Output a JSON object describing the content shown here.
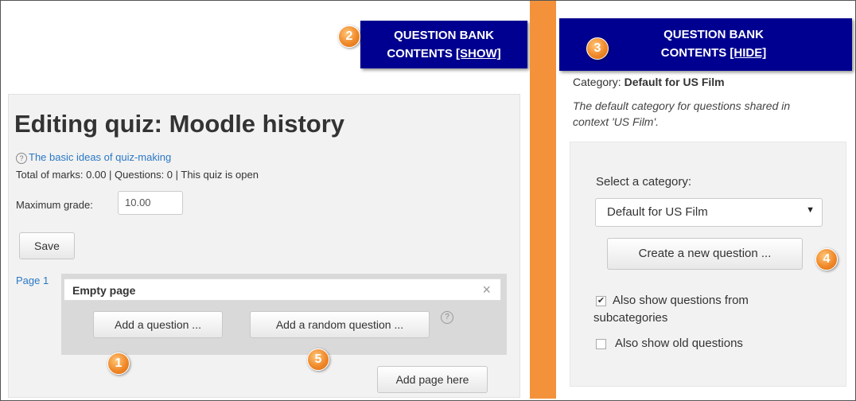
{
  "left": {
    "qb_tab": {
      "line1": "QUESTION BANK",
      "line2_prefix": "CONTENTS ",
      "line2_link": "[SHOW]"
    },
    "badge2": "2",
    "title": "Editing quiz: Moodle history",
    "help_icon": "?",
    "help_link": "The basic ideas of quiz-making",
    "totals": "Total of marks: 0.00 | Questions: 0 | This quiz is open",
    "max_grade_label": "Maximum grade:",
    "max_grade_value": "10.00",
    "save_label": "Save",
    "page_label": "Page 1",
    "empty_page": "Empty page",
    "close_glyph": "×",
    "add_question": "Add a question ...",
    "add_random_question": "Add a random question ...",
    "random_help_icon": "?",
    "add_page_here": "Add page here",
    "badge1": "1",
    "badge5": "5"
  },
  "right": {
    "qb_tab": {
      "line1": "QUESTION BANK",
      "line2_prefix": "CONTENTS ",
      "line2_link": "[HIDE]"
    },
    "badge3": "3",
    "category_prefix": "Category: ",
    "category_name": "Default for US Film",
    "category_desc": "The default category for questions shared in context 'US Film'.",
    "select_label": "Select a category:",
    "select_value": "Default for US Film",
    "create_button": "Create a new question ...",
    "badge4": "4",
    "show_sub_label": "Also show questions from subcategories",
    "show_sub_checked": true,
    "show_old_label": "Also show old questions",
    "show_old_checked": false
  },
  "colors": {
    "tab_bg": "#000090",
    "separator": "#f3923a",
    "badge": "#f0892a",
    "link": "#2a78c5"
  },
  "icons": [
    "help-icon",
    "close-icon",
    "chevron-down-icon",
    "checkbox-icon"
  ]
}
